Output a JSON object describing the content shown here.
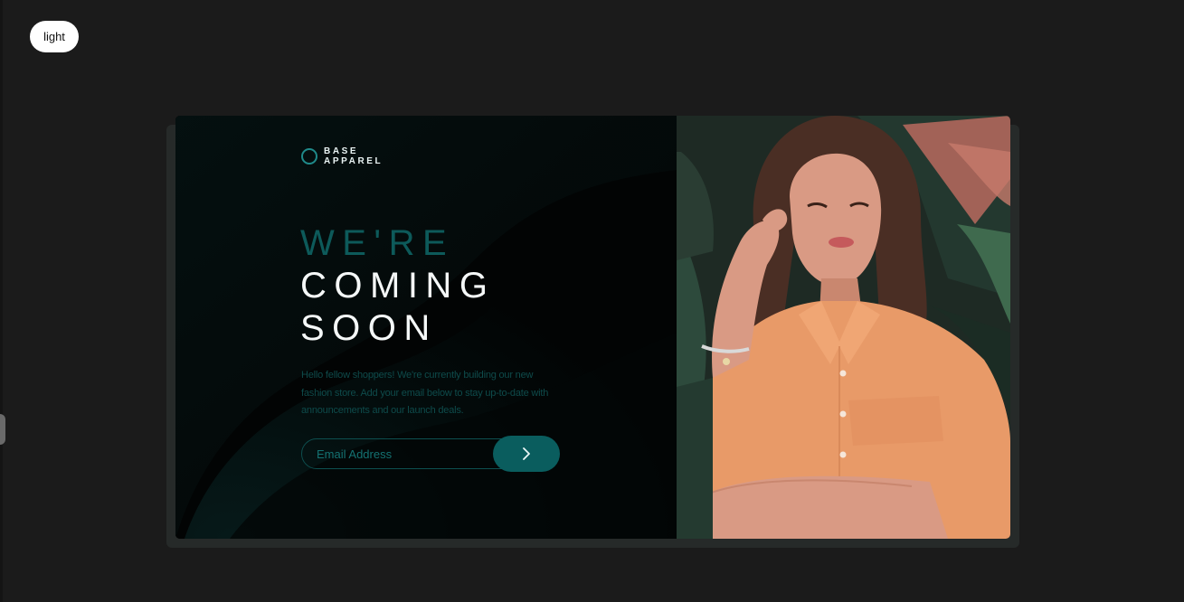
{
  "theme_toggle": {
    "label": "light"
  },
  "brand": {
    "line1": "BASE",
    "line2": "APPAREL"
  },
  "headline": {
    "line1": "WE'RE",
    "line2": "COMING",
    "line3": "SOON"
  },
  "intro": "Hello fellow shoppers! We're currently building our new fashion store. Add your email below to stay up-to-date with announcements and our launch deals.",
  "form": {
    "email_placeholder": "Email Address",
    "submit_icon": "chevron-right-icon"
  },
  "hero_image": {
    "subject": "woman-in-orange-shirt-photo"
  },
  "colors": {
    "page_bg": "#1b1b1b",
    "accent": "#1f8a8a",
    "button": "#0a5d5e",
    "shirt": "#e89a68"
  }
}
